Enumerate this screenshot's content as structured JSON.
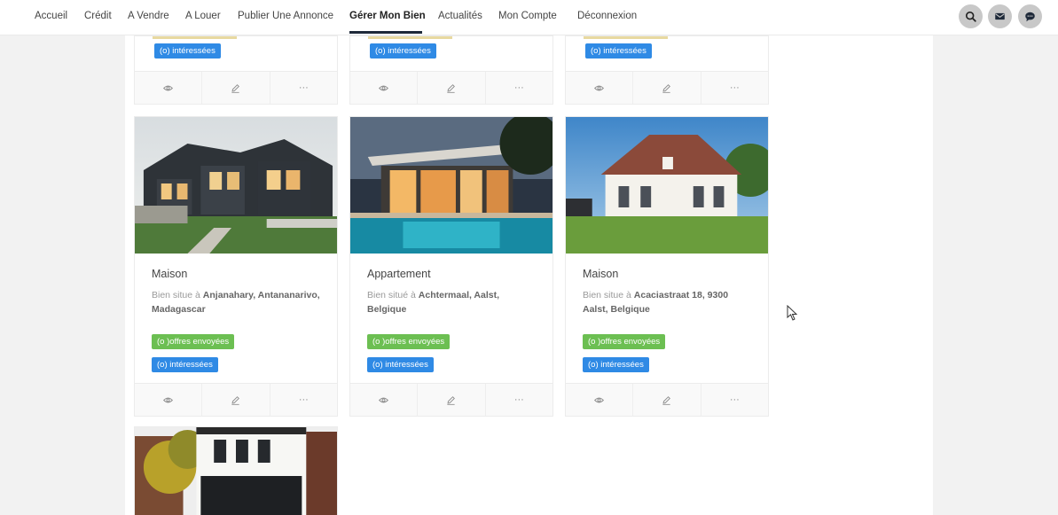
{
  "nav": {
    "items": [
      "Accueil",
      "Crédit",
      "A Vendre",
      "A Louer",
      "Publier Une Annonce",
      "Gérer Mon Bien",
      "Actualités",
      "Mon Compte",
      "Déconnexion"
    ],
    "active": "Gérer Mon Bien",
    "icons": [
      "search-icon",
      "mail-icon",
      "chat-icon"
    ]
  },
  "top_cards": [
    {
      "badge_interested": "(o) intéressées"
    },
    {
      "badge_interested": "(o) intéressées"
    },
    {
      "badge_interested": "(o) intéressées"
    }
  ],
  "cards": [
    {
      "type": "Maison",
      "loc_prefix": "Bien situe à ",
      "loc_bold": "Anjanahary, Antananarivo, Madagascar",
      "badge_offers": "(o )offres envoyées",
      "badge_interested": "(o) intéressées"
    },
    {
      "type": "Appartement",
      "loc_prefix": "Bien situé à ",
      "loc_bold": "Achtermaal, Aalst, Belgique",
      "badge_offers": "(o )offres envoyées",
      "badge_interested": "(o) intéressées"
    },
    {
      "type": "Maison",
      "loc_prefix": "Bien situe à ",
      "loc_bold": "Acaciastraat 18, 9300 Aalst, Belgique",
      "badge_offers": "(o )offres envoyées",
      "badge_interested": "(o) intéressées"
    }
  ],
  "actions": {
    "view": "eye-icon",
    "edit": "pencil-icon",
    "more": "···"
  },
  "colors": {
    "offers_badge": "#6cbf52",
    "interested_badge": "#2f8ae5",
    "nav_active": "#1f2a3a"
  }
}
